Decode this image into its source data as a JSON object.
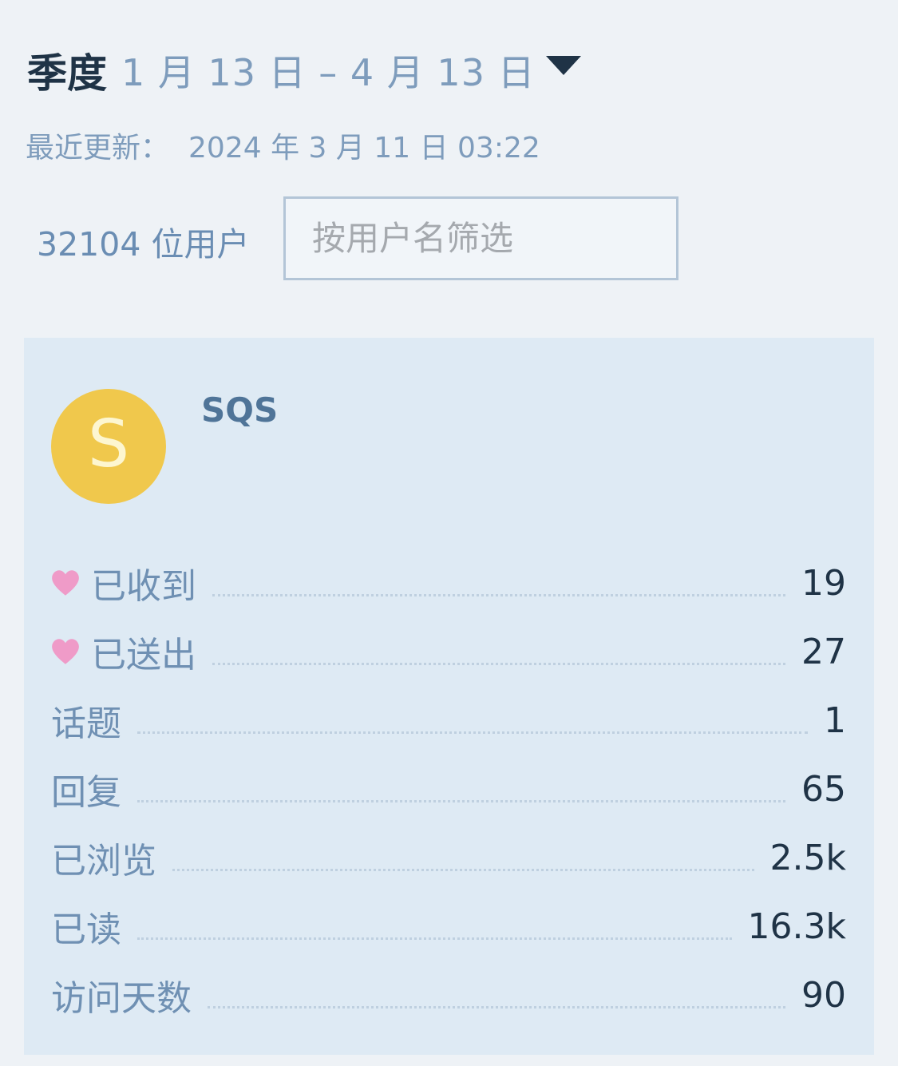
{
  "header": {
    "period_label": "季度",
    "period_range": "1 月 13 日 – 4 月 13 日",
    "caret_icon": "caret-down-icon"
  },
  "updated": {
    "label": "最近更新：",
    "value": "2024 年 3 月 11 日 03:22"
  },
  "filter": {
    "user_count": "32104 位用户",
    "placeholder": "按用户名筛选",
    "value": ""
  },
  "user": {
    "avatar_letter": "S",
    "name": "SQS",
    "avatar_color": "#f0c84c"
  },
  "stats": [
    {
      "icon": "heart-icon",
      "label": "已收到",
      "value": "19"
    },
    {
      "icon": "heart-icon",
      "label": "已送出",
      "value": "27"
    },
    {
      "icon": "",
      "label": "话题",
      "value": "1"
    },
    {
      "icon": "",
      "label": "回复",
      "value": "65"
    },
    {
      "icon": "",
      "label": "已浏览",
      "value": "2.5k"
    },
    {
      "icon": "",
      "label": "已读",
      "value": "16.3k"
    },
    {
      "icon": "",
      "label": "访问天数",
      "value": "90"
    }
  ],
  "colors": {
    "heart": "#ef9bc8",
    "card_background": "#deeaf4",
    "page_background": "#eef2f6"
  }
}
